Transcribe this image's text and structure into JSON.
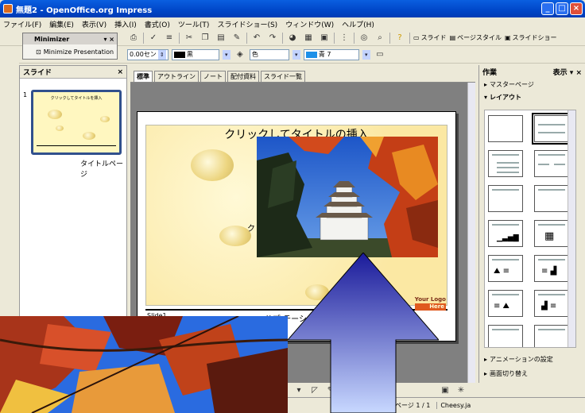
{
  "window": {
    "title": "無題2 - OpenOffice.org Impress",
    "buttons": [
      "_",
      "□",
      "×"
    ]
  },
  "menu": [
    "ファイル(F)",
    "編集(E)",
    "表示(V)",
    "挿入(I)",
    "書式(O)",
    "ツール(T)",
    "スライドショー(S)",
    "ウィンドウ(W)",
    "ヘルプ(H)"
  ],
  "toolbar1": {
    "slide_label": "スライド",
    "page_style_label": "ページスタイル",
    "slideshow_label": "スライドショー"
  },
  "toolbar2": {
    "line_width": "0.00セン",
    "line_color": "黒",
    "fill_label": "色",
    "fill_color": "青 7",
    "fill_color_hex": "#1e90e8"
  },
  "minimizer": {
    "title": "Minimizer",
    "item": "Minimize Presentation"
  },
  "slides_panel": {
    "title": "スライド",
    "slide_number": "1",
    "thumb_title": "クリックしてタイトルを挿入",
    "caption": "タイトルページ"
  },
  "tabs": [
    "標準",
    "アウトライン",
    "ノート",
    "配付資料",
    "スライド一覧"
  ],
  "slide": {
    "title": "クリックしてタイトルの挿入",
    "body_fragment": "ク",
    "footer_left": "Slide1",
    "footer_center": "サブ テーシ",
    "logo_text": "Your Logo",
    "logo_sub": "Here"
  },
  "task_panel": {
    "title": "作業",
    "view_label": "表示",
    "master_pages": "マスターページ",
    "layout": "レイアウト",
    "animation": "アニメーションの設定",
    "transition": "画面切り替え"
  },
  "status": {
    "page": "ページ 1 / 1",
    "master": "Cheesy.ja"
  }
}
